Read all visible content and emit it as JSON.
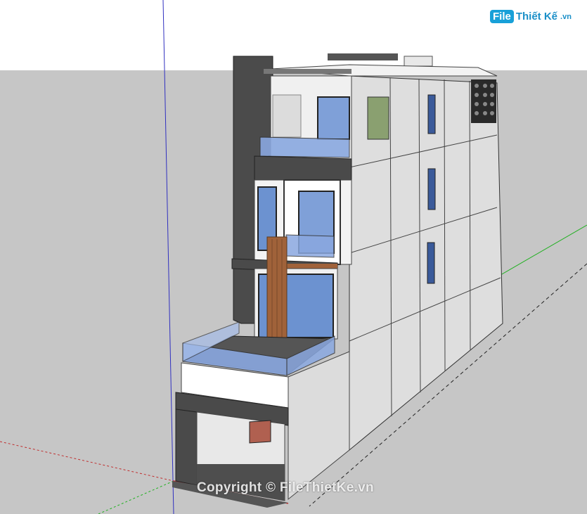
{
  "logo": {
    "badge": "File",
    "name": "Thiết Kế",
    "tld": ".vn"
  },
  "watermark": "Copyright © FileThietKe.vn",
  "colors": {
    "sky": "#ffffff",
    "ground": "#c8c8c8",
    "wall_light": "#e6e6e6",
    "wall_side": "#dcdcdc",
    "dark_panel": "#4a4a4a",
    "glass": "#7f9fd8",
    "wood": "#a0623a",
    "axis_blue": "#3030c0",
    "axis_green": "#20b020",
    "axis_red": "#c03030"
  }
}
